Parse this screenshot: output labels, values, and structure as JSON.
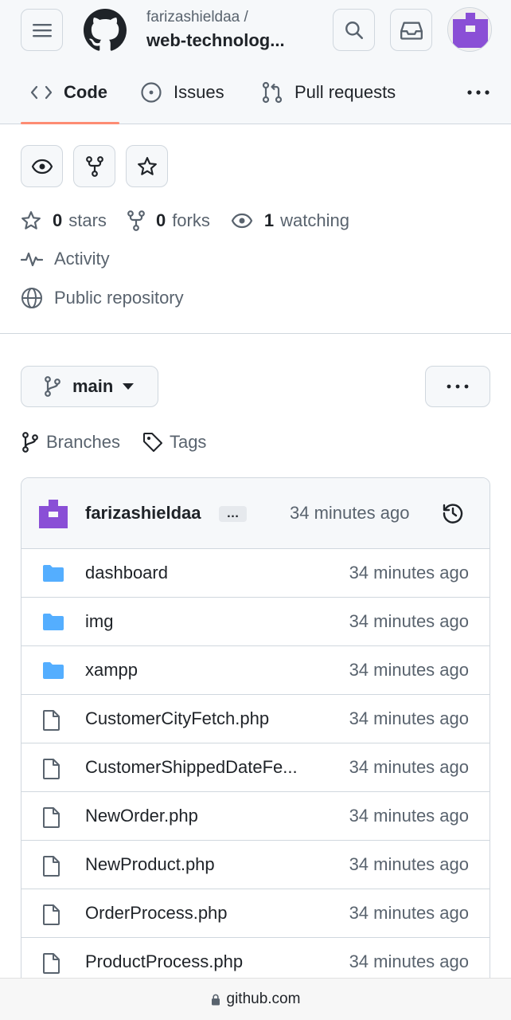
{
  "header": {
    "owner": "farizashieldaa /",
    "repo": "web-technolog..."
  },
  "tabs": [
    {
      "label": "Code",
      "icon": "code-icon",
      "active": true
    },
    {
      "label": "Issues",
      "icon": "issue-opened-icon"
    },
    {
      "label": "Pull requests",
      "icon": "git-pull-request-icon"
    }
  ],
  "stats": {
    "stars_count": "0",
    "stars_label": "stars",
    "forks_count": "0",
    "forks_label": "forks",
    "watching_count": "1",
    "watching_label": "watching",
    "activity": "Activity",
    "visibility": "Public repository"
  },
  "branch": {
    "name": "main",
    "branches_label": "Branches",
    "tags_label": "Tags"
  },
  "commit": {
    "author": "farizashieldaa",
    "ellipsis": "…",
    "time": "34 minutes ago"
  },
  "files": [
    {
      "name": "dashboard",
      "type": "folder",
      "time": "34 minutes ago"
    },
    {
      "name": "img",
      "type": "folder",
      "time": "34 minutes ago"
    },
    {
      "name": "xampp",
      "type": "folder",
      "time": "34 minutes ago"
    },
    {
      "name": "CustomerCityFetch.php",
      "type": "file",
      "time": "34 minutes ago"
    },
    {
      "name": "CustomerShippedDateFe...",
      "type": "file",
      "time": "34 minutes ago"
    },
    {
      "name": "NewOrder.php",
      "type": "file",
      "time": "34 minutes ago"
    },
    {
      "name": "NewProduct.php",
      "type": "file",
      "time": "34 minutes ago"
    },
    {
      "name": "OrderProcess.php",
      "type": "file",
      "time": "34 minutes ago"
    },
    {
      "name": "ProductProcess.php",
      "type": "file",
      "time": "34 minutes ago"
    }
  ],
  "browser": {
    "url": "github.com"
  },
  "colors": {
    "accent_underline": "#fd8c73",
    "folder": "#54aeff",
    "avatar": "#8a4fd6",
    "muted_text": "#59636e"
  }
}
